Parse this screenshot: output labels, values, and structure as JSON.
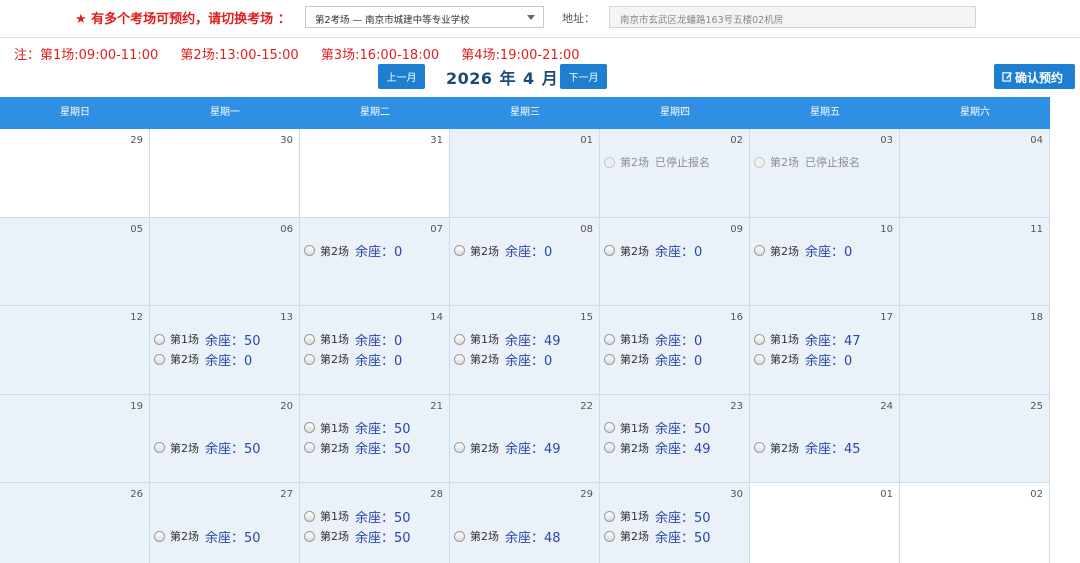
{
  "header": {
    "notice": "★ 有多个考场可预约，请切换考场 ：",
    "venue_selected": "第2考场 — 南京市城建中等专业学校",
    "address_label": "地址：",
    "address_value": "南京市玄武区龙蟠路163号五楼02机房"
  },
  "session_note": {
    "s1": "注：第1场:09:00-11:00",
    "s2": "第2场:13:00-15:00",
    "s3": "第3场:16:00-18:00",
    "s4": "第4场:19:00-21:00"
  },
  "nav": {
    "prev_label": "上一月",
    "next_label": "下一月",
    "year": "2026",
    "year_unit": "年",
    "month": "4",
    "month_unit": "月",
    "confirm_label": "确认预约"
  },
  "weekdays": [
    "星期日",
    "星期一",
    "星期二",
    "星期三",
    "星期四",
    "星期五",
    "星期六"
  ],
  "icons": {
    "venue": "chevron-down-icon",
    "confirm": "edit-icon",
    "slot": "radio-icon"
  },
  "colors": {
    "accent": "#1e7fd0",
    "header_row": "#2f8fe3",
    "notice": "#e01e1e",
    "seats": "#2a47a6",
    "cell": "#eaf1f8"
  },
  "seat_label": "余座：",
  "weeks": [
    [
      {
        "day": "29",
        "white": true,
        "slots": []
      },
      {
        "day": "30",
        "white": true,
        "slots": []
      },
      {
        "day": "31",
        "white": true,
        "slots": []
      },
      {
        "day": "01",
        "slots": []
      },
      {
        "day": "02",
        "slots": [
          {
            "name": "第2场",
            "status": "已停止报名"
          }
        ]
      },
      {
        "day": "03",
        "slots": [
          {
            "name": "第2场",
            "status": "已停止报名"
          }
        ]
      },
      {
        "day": "04",
        "slots": []
      }
    ],
    [
      {
        "day": "05",
        "slots": []
      },
      {
        "day": "06",
        "slots": []
      },
      {
        "day": "07",
        "slots": [
          {
            "name": "第2场",
            "seats": "0"
          }
        ]
      },
      {
        "day": "08",
        "slots": [
          {
            "name": "第2场",
            "seats": "0"
          }
        ]
      },
      {
        "day": "09",
        "slots": [
          {
            "name": "第2场",
            "seats": "0"
          }
        ]
      },
      {
        "day": "10",
        "slots": [
          {
            "name": "第2场",
            "seats": "0"
          }
        ]
      },
      {
        "day": "11",
        "slots": []
      }
    ],
    [
      {
        "day": "12",
        "slots": []
      },
      {
        "day": "13",
        "slots": [
          {
            "name": "第1场",
            "seats": "50"
          },
          {
            "name": "第2场",
            "seats": "0"
          }
        ]
      },
      {
        "day": "14",
        "slots": [
          {
            "name": "第1场",
            "seats": "0"
          },
          {
            "name": "第2场",
            "seats": "0"
          }
        ]
      },
      {
        "day": "15",
        "slots": [
          {
            "name": "第1场",
            "seats": "49"
          },
          {
            "name": "第2场",
            "seats": "0"
          }
        ]
      },
      {
        "day": "16",
        "slots": [
          {
            "name": "第1场",
            "seats": "0"
          },
          {
            "name": "第2场",
            "seats": "0"
          }
        ]
      },
      {
        "day": "17",
        "slots": [
          {
            "name": "第1场",
            "seats": "47"
          },
          {
            "name": "第2场",
            "seats": "0"
          }
        ]
      },
      {
        "day": "18",
        "slots": []
      }
    ],
    [
      {
        "day": "19",
        "slots": []
      },
      {
        "day": "20",
        "slots": [
          {
            "name": "第2场",
            "seats": "50",
            "row": 2
          }
        ]
      },
      {
        "day": "21",
        "slots": [
          {
            "name": "第1场",
            "seats": "50"
          },
          {
            "name": "第2场",
            "seats": "50"
          }
        ]
      },
      {
        "day": "22",
        "slots": [
          {
            "name": "第2场",
            "seats": "49",
            "row": 2
          }
        ]
      },
      {
        "day": "23",
        "slots": [
          {
            "name": "第1场",
            "seats": "50"
          },
          {
            "name": "第2场",
            "seats": "49"
          }
        ]
      },
      {
        "day": "24",
        "slots": [
          {
            "name": "第2场",
            "seats": "45",
            "row": 2
          }
        ]
      },
      {
        "day": "25",
        "slots": []
      }
    ],
    [
      {
        "day": "26",
        "slots": []
      },
      {
        "day": "27",
        "slots": [
          {
            "name": "第2场",
            "seats": "50",
            "row": 2
          }
        ]
      },
      {
        "day": "28",
        "slots": [
          {
            "name": "第1场",
            "seats": "50"
          },
          {
            "name": "第2场",
            "seats": "50"
          }
        ]
      },
      {
        "day": "29",
        "slots": [
          {
            "name": "第2场",
            "seats": "48",
            "row": 2
          }
        ]
      },
      {
        "day": "30",
        "slots": [
          {
            "name": "第1场",
            "seats": "50"
          },
          {
            "name": "第2场",
            "seats": "50"
          }
        ]
      },
      {
        "day": "01",
        "white": true,
        "slots": []
      },
      {
        "day": "02",
        "white": true,
        "slots": []
      }
    ]
  ]
}
